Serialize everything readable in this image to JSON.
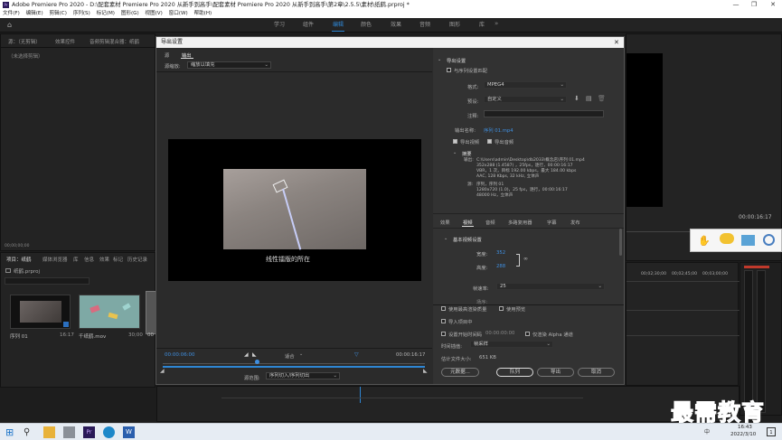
{
  "window": {
    "title": "Adobe Premiere Pro 2020 - D:\\配套素材 Premiere Pro 2020 从新手到高手\\配套素材 Premiere Pro 2020 从新手到高手\\第2章\\2.5.5\\素材\\纸鹤.prproj *",
    "minimize": "—",
    "maximize": "❐",
    "close": "✕"
  },
  "menu": [
    "文件(F)",
    "编辑(E)",
    "剪辑(C)",
    "序列(S)",
    "标记(M)",
    "图形(G)",
    "视图(V)",
    "窗口(W)",
    "帮助(H)"
  ],
  "workspaces": [
    "学习",
    "组件",
    "编辑",
    "颜色",
    "效果",
    "音频",
    "图形",
    "库"
  ],
  "workspace_active": "编辑",
  "source_panel": {
    "tab1": "源：（无剪辑）",
    "tab2": "效果控件",
    "tab3": "音频剪辑混合器：纸鹤",
    "empty": "（未选择剪辑）",
    "timecode": "00;00;00;00"
  },
  "project_panel": {
    "tabs": [
      "项目：纸鹤",
      "媒体浏览器",
      "库",
      "信息",
      "效果",
      "标记",
      "历史记录"
    ],
    "file": "纸鹤.prproj",
    "items": [
      {
        "name": "序列 01",
        "duration": "16:17"
      },
      {
        "name": "千纸鹤.mov",
        "duration": "30;00"
      },
      {
        "name": "00"
      }
    ]
  },
  "timeline": {
    "times": [
      "00;02;30;00",
      "00;02;45;00",
      "00;03;00;00"
    ],
    "program_tc": "00:00:16:17"
  },
  "dialog": {
    "title": "导出设置",
    "close": "✕",
    "tabs": {
      "source": "源",
      "output": "输出"
    },
    "source_scaling_label": "源缩放:",
    "source_scaling_value": "缩放以填充",
    "preview_caption": "线性镭版的所在",
    "timecode_in": "00:00:06:00",
    "timecode_out": "00:00:16:17",
    "fit_label": "适合",
    "source_range_label": "源范围:",
    "source_range_value": "序列切入/序列切出",
    "export_settings": {
      "header": "导出设置",
      "match_sequence": "与序列设置匹配",
      "format_label": "格式:",
      "format_value": "MPEG4",
      "preset_label": "预设:",
      "preset_value": "自定义",
      "comments_label": "注释:",
      "output_name_label": "输出名称:",
      "output_name_value": "序列 01.mp4",
      "export_video": "导出视频",
      "export_audio": "导出音频"
    },
    "summary": {
      "header": "摘要",
      "output_label": "输出:",
      "output_lines": [
        "C:\\Users\\admin\\Desktop\\db2033\\概念店\\序列 01.mp4",
        "352x288 (1.4587) ，25fps，逐行，00:00:16:17",
        "VBR，1 次，目标 192.00 kbps，最大 184.00 kbps",
        "AAC, 128 Kbps, 32  kHz, 立体声"
      ],
      "source_label": "源:",
      "source_lines": [
        "序列，序列 01",
        "1280x720 (1.0)，25 fps，逐行，00:00:16:17",
        "48000 Hz，立体声"
      ]
    },
    "settings_tabs": [
      "效果",
      "视频",
      "音频",
      "多路复用器",
      "字幕",
      "发布"
    ],
    "settings_tab_active": "视频",
    "basic_video": {
      "header": "基本视频设置",
      "width_label": "宽度:",
      "width_value": "352",
      "height_label": "高度:",
      "height_value": "288",
      "framerate_label": "帧速率:",
      "framerate_value": "25",
      "field_order_label": "场序:"
    },
    "options": {
      "max_depth": "使用最高渲染质量",
      "use_previews": "使用预览",
      "import_project": "导入项目中",
      "set_start_tc": "设置开始时间码",
      "start_tc_value": "00:00:00:00",
      "render_alpha": "仅渲染 Alpha 通道",
      "time_interp_label": "时间插值:",
      "time_interp_value": "帧采样",
      "file_size_label": "估计文件大小:",
      "file_size_value": "651 KB"
    },
    "buttons": {
      "metadata": "元数据...",
      "queue": "队列",
      "export": "导出",
      "cancel": "取消"
    }
  },
  "right_toolbar": {
    "tc": "00:00:16:17"
  },
  "watermark": "最需教育",
  "taskbar": {
    "time": "16:43",
    "date": "2022/3/10",
    "lang": "中",
    "notify": "1"
  },
  "colors": {
    "accent": "#2e86d4",
    "timecode": "#3f8fe0",
    "background": "#1d1d1d"
  }
}
